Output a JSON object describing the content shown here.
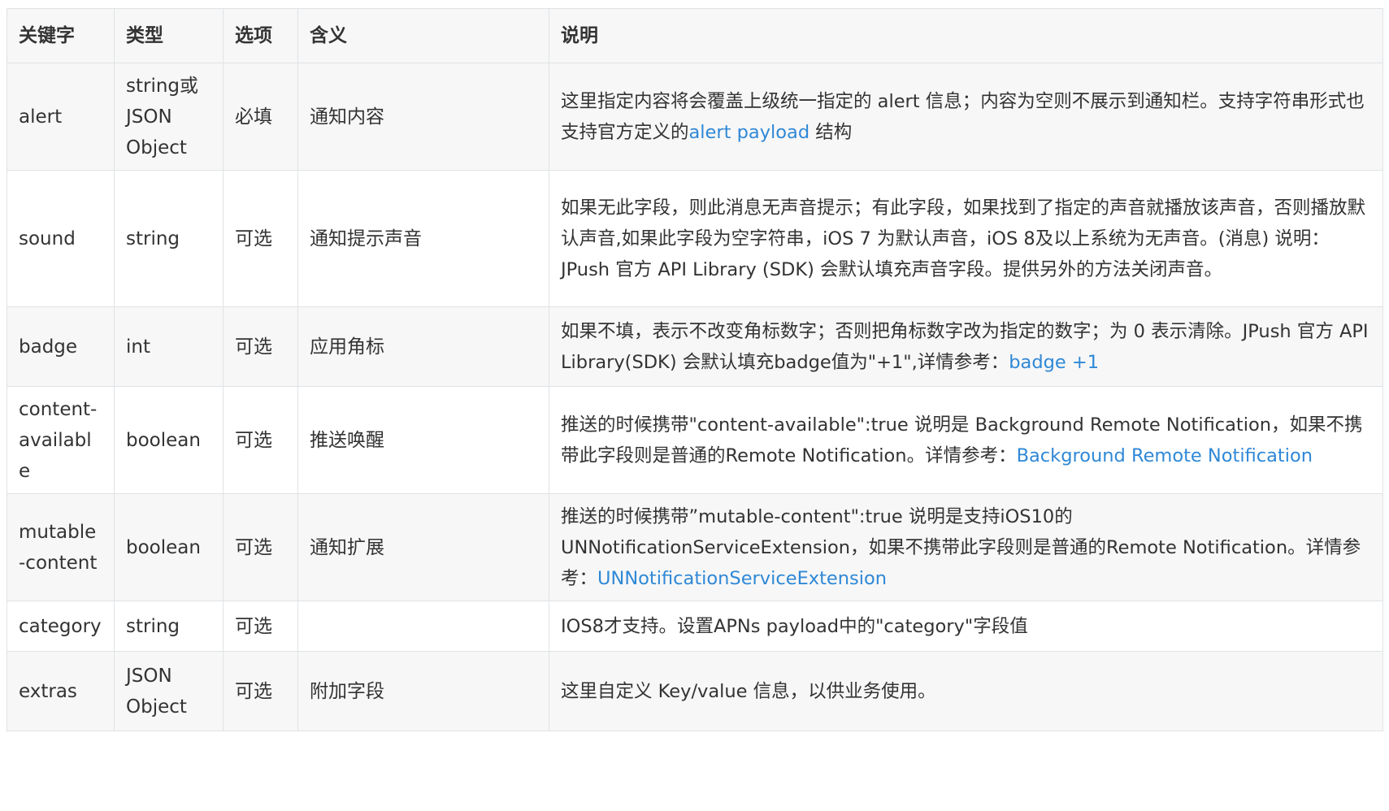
{
  "table": {
    "headers": [
      "关键字",
      "类型",
      "选项",
      "含义",
      "说明"
    ],
    "rows": [
      {
        "key": "alert",
        "type": "string或JSON Object",
        "option": "必填",
        "meaning": "通知内容",
        "desc": [
          {
            "text": "这里指定内容将会覆盖上级统一指定的 alert 信息；内容为空则不展示到通知栏。支持字符串形式也支持官方定义的"
          },
          {
            "text": "alert payload",
            "link": true
          },
          {
            "text": " 结构"
          }
        ]
      },
      {
        "key": "sound",
        "type": "string",
        "option": "可选",
        "meaning": "通知提示声音",
        "desc": [
          {
            "text": "如果无此字段，则此消息无声音提示；有此字段，如果找到了指定的声音就播放该声音，否则播放默认声音,如果此字段为空字符串，iOS 7 为默认声音，iOS 8及以上系统为无声音。(消息) 说明：JPush 官方 API Library (SDK) 会默认填充声音字段。提供另外的方法关闭声音。"
          }
        ]
      },
      {
        "key": "badge",
        "type": "int",
        "option": "可选",
        "meaning": "应用角标",
        "desc": [
          {
            "text": "如果不填，表示不改变角标数字；否则把角标数字改为指定的数字；为 0 表示清除。JPush 官方 API Library(SDK) 会默认填充badge值为\"+1\",详情参考："
          },
          {
            "text": "badge +1",
            "link": true
          }
        ]
      },
      {
        "key": "content-available",
        "type": "boolean",
        "option": "可选",
        "meaning": "推送唤醒",
        "desc": [
          {
            "text": "推送的时候携带\"content-available\":true 说明是 Background Remote Notification，如果不携带此字段则是普通的Remote Notification。详情参考："
          },
          {
            "text": "Background Remote Notification",
            "link": true
          }
        ]
      },
      {
        "key": "mutable-content",
        "type": "boolean",
        "option": "可选",
        "meaning": "通知扩展",
        "desc": [
          {
            "text": "推送的时候携带”mutable-content\":true 说明是支持iOS10的UNNotificationServiceExtension，如果不携带此字段则是普通的Remote Notification。详情参考："
          },
          {
            "text": "UNNotificationServiceExtension",
            "link": true
          }
        ]
      },
      {
        "key": "category",
        "type": "string",
        "option": "可选",
        "meaning": "",
        "desc": [
          {
            "text": "IOS8才支持。设置APNs payload中的\"category\"字段值"
          }
        ]
      },
      {
        "key": "extras",
        "type": "JSON Object",
        "option": "可选",
        "meaning": "附加字段",
        "desc": [
          {
            "text": "这里自定义 Key/value 信息，以供业务使用。"
          }
        ]
      }
    ]
  },
  "colors": {
    "link": "#2f88d6",
    "text": "#333333",
    "border": "#dfe2e5",
    "stripe": "#f7f7f7"
  }
}
